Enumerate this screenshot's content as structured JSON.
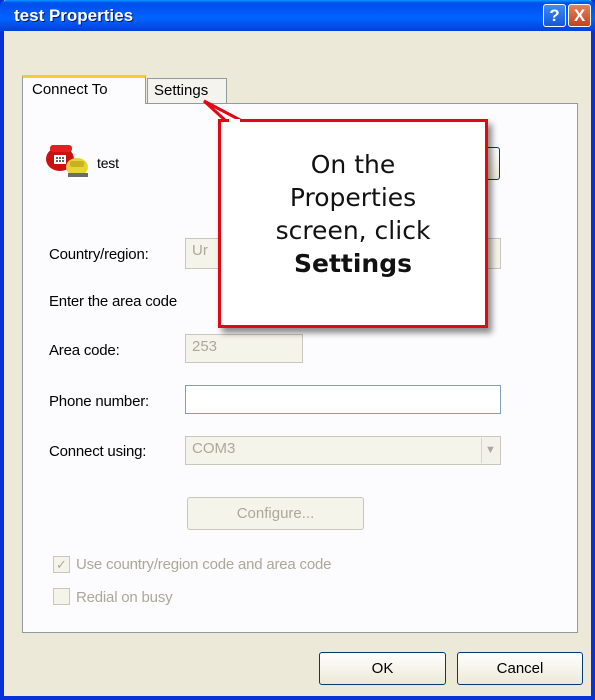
{
  "window": {
    "title": "test Properties"
  },
  "titlebar_buttons": {
    "help": "?",
    "close": "X"
  },
  "tabs": [
    {
      "label": "Connect To",
      "selected": true
    },
    {
      "label": "Settings",
      "selected": false
    }
  ],
  "connection": {
    "name": "test",
    "icon": "telephone-icon"
  },
  "form": {
    "country_label": "Country/region:",
    "country_value": "Ur",
    "area_instructions": "Enter the area code",
    "area_code_label": "Area code:",
    "area_code_value": "253",
    "phone_label": "Phone number:",
    "phone_value": "",
    "connect_using_label": "Connect using:",
    "connect_using_value": "COM3",
    "configure_label": "Configure...",
    "use_country_code_label": "Use country/region code and area code",
    "use_country_code_checked": true,
    "redial_label": "Redial on busy",
    "redial_checked": false
  },
  "footer": {
    "ok_label": "OK",
    "cancel_label": "Cancel"
  },
  "callout": {
    "line1": "On the",
    "line2": "Properties",
    "line3": "screen, click",
    "line4": "Settings",
    "border_color": "#e30613"
  },
  "colors": {
    "titlebar": "#0053ee",
    "window_bg": "#ece9d8",
    "accent_tab": "#ffc83c"
  }
}
